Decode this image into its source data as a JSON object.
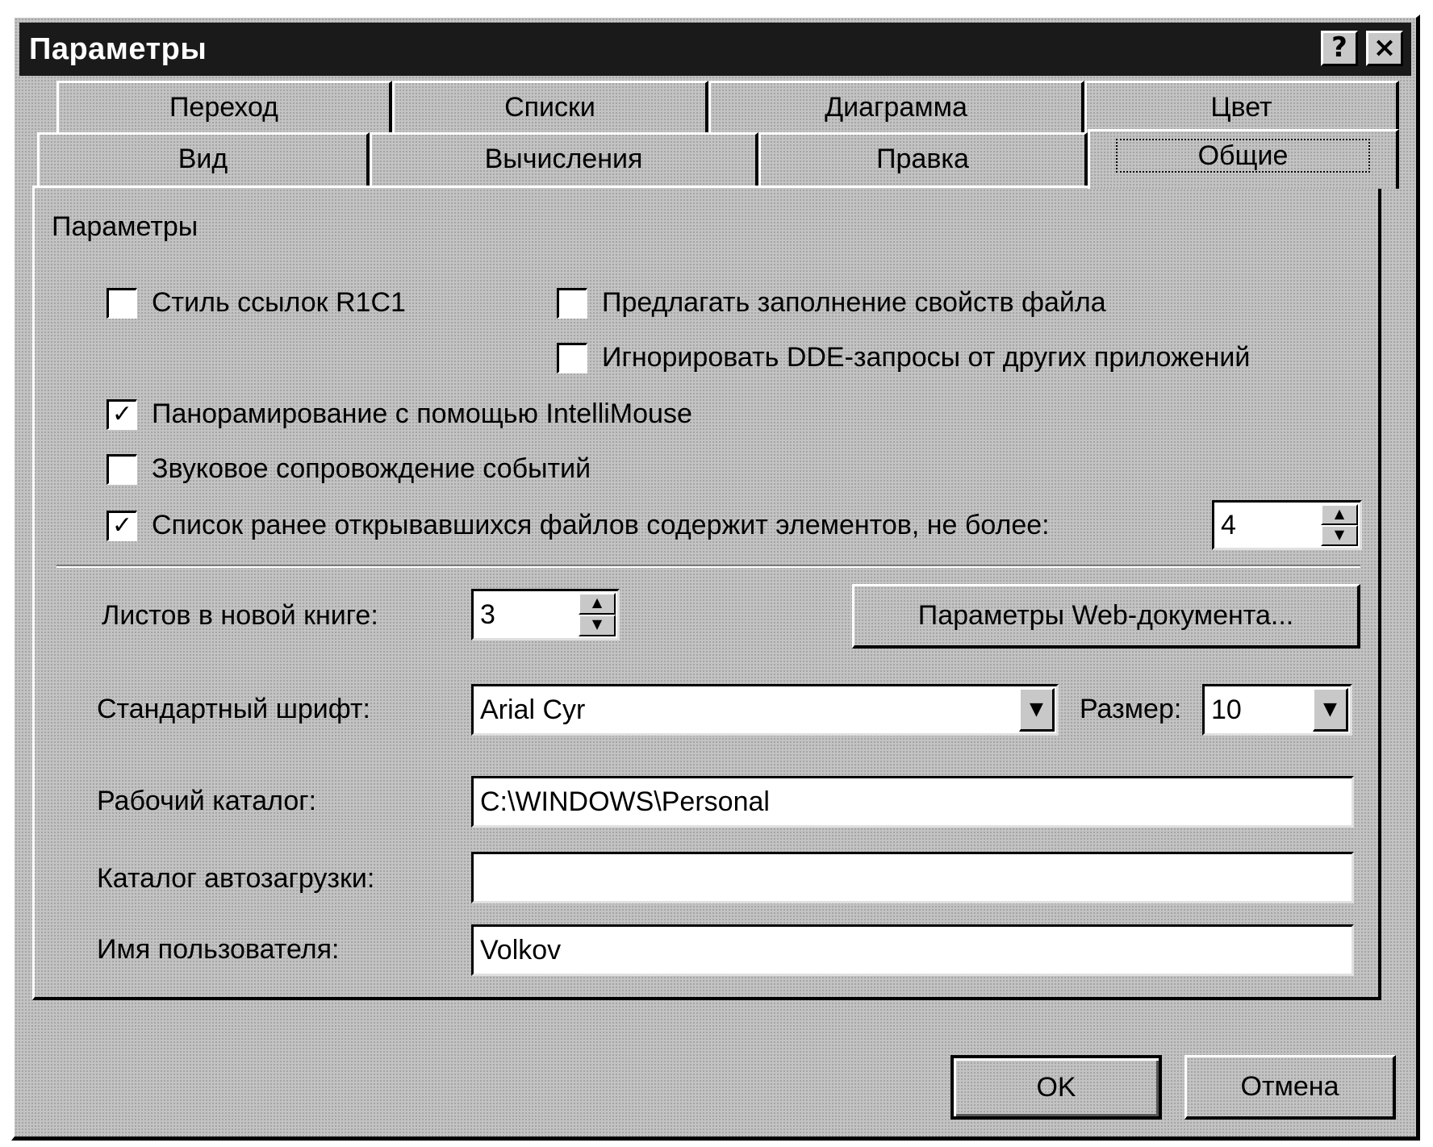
{
  "window": {
    "title": "Параметры",
    "help_glyph": "?",
    "close_glyph": "×"
  },
  "tabs": {
    "row_back": [
      "Переход",
      "Списки",
      "Диаграмма",
      "Цвет"
    ],
    "row_front": [
      "Вид",
      "Вычисления",
      "Правка",
      "Общие"
    ],
    "active": "Общие"
  },
  "group": {
    "label": "Параметры"
  },
  "options": {
    "r1c1": {
      "label": "Стиль ссылок R1C1",
      "checked": false
    },
    "file_props": {
      "label": "Предлагать заполнение свойств файла",
      "checked": false
    },
    "ignore_dde": {
      "label": "Игнорировать DDE-запросы от других приложений",
      "checked": false
    },
    "intellimouse": {
      "label": "Панорамирование с помощью IntelliMouse",
      "checked": true
    },
    "sound": {
      "label": "Звуковое сопровождение событий",
      "checked": false
    },
    "recent_files": {
      "label": "Список ранее открывавшихся файлов содержит элементов, не более:",
      "checked": true,
      "count": "4"
    }
  },
  "sheets": {
    "label": "Листов в новой книге:",
    "value": "3"
  },
  "web_button": "Параметры Web-документа...",
  "font": {
    "label": "Стандартный шрифт:",
    "value": "Arial Cyr"
  },
  "size": {
    "label": "Размер:",
    "value": "10"
  },
  "workdir": {
    "label": "Рабочий каталог:",
    "value": "C:\\WINDOWS\\Personal"
  },
  "autoload": {
    "label": "Каталог автозагрузки:",
    "value": ""
  },
  "username": {
    "label": "Имя пользователя:",
    "value": "Volkov"
  },
  "buttons": {
    "ok": "OK",
    "cancel": "Отмена"
  },
  "glyphs": {
    "check": "✓",
    "spin_up": "▲",
    "spin_down": "▼",
    "dropdown": "▼"
  }
}
